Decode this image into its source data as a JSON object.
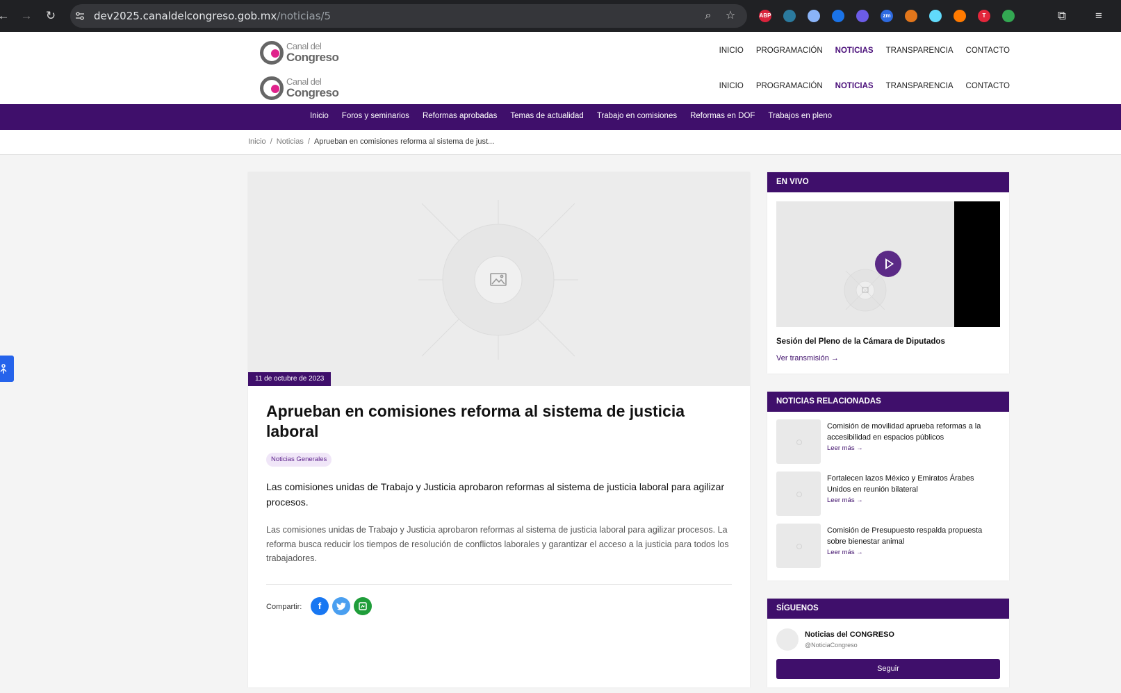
{
  "browser": {
    "url_host": "dev2025.canaldelcongreso.gob.mx",
    "url_path": "/noticias/5",
    "extensions": [
      {
        "name": "adblock-plus-icon",
        "label": "ABP",
        "color": "#d9233c"
      },
      {
        "name": "extension-icon-2",
        "label": "",
        "color": "#2b7a9e"
      },
      {
        "name": "extension-icon-3",
        "label": "",
        "color": "#8ab4f8"
      },
      {
        "name": "extension-icon-4",
        "label": "",
        "color": "#1a73e8"
      },
      {
        "name": "extension-icon-5",
        "label": "",
        "color": "#6c5ce7"
      },
      {
        "name": "zoom-extension-icon",
        "label": "zm",
        "color": "#2d6ae0"
      },
      {
        "name": "metamask-icon",
        "label": "",
        "color": "#e2761b"
      },
      {
        "name": "react-devtools-icon",
        "label": "",
        "color": "#61dafb"
      },
      {
        "name": "extension-icon-9",
        "label": "",
        "color": "#ff7a00"
      },
      {
        "name": "extension-icon-10",
        "label": "T",
        "color": "#e3263b"
      },
      {
        "name": "extension-icon-11",
        "label": "",
        "color": "#33a852"
      }
    ]
  },
  "site": {
    "logo_line1": "Canal del",
    "logo_line2": "Congreso",
    "nav": [
      "INICIO",
      "PROGRAMACIÓN",
      "NOTICIAS",
      "TRANSPARENCIA",
      "CONTACTO"
    ],
    "active_nav": "NOTICIAS",
    "subnav": [
      "Inicio",
      "Foros y seminarios",
      "Reformas aprobadas",
      "Temas de actualidad",
      "Trabajo en comisiones",
      "Reformas en DOF",
      "Trabajos en pleno"
    ],
    "breadcrumb": {
      "home": "Inicio",
      "section": "Noticias",
      "current": "Aprueban en comisiones reforma al sistema de just...",
      "separator": "/"
    }
  },
  "article": {
    "date": "11 de octubre de 2023",
    "title": "Aprueban en comisiones reforma al sistema de justicia laboral",
    "tag": "Noticias Generales",
    "lead": "Las comisiones unidas de Trabajo y Justicia aprobaron reformas al sistema de justicia laboral para agilizar procesos.",
    "body": "Las comisiones unidas de Trabajo y Justicia aprobaron reformas al sistema de justicia laboral para agilizar procesos. La reforma busca reducir los tiempos de resolución de conflictos laborales y garantizar el acceso a la justicia para todos los trabajadores.",
    "share_label": "Compartir:"
  },
  "sidebar": {
    "live": {
      "heading": "EN VIVO",
      "title": "Sesión del Pleno de la Cámara de Diputados",
      "link": "Ver transmisión →"
    },
    "related": {
      "heading": "NOTICIAS RELACIONADAS",
      "items": [
        {
          "title": "Comisión de movilidad aprueba reformas a la accesibilidad en espacios públicos",
          "link": "Leer más →"
        },
        {
          "title": "Fortalecen lazos México y Emiratos Árabes Unidos en reunión bilateral",
          "link": "Leer más →"
        },
        {
          "title": "Comisión de Presupuesto respalda propuesta sobre bienestar animal",
          "link": "Leer más →"
        }
      ]
    },
    "follow": {
      "heading": "SÍGUENOS",
      "name": "Noticias del CONGRESO",
      "handle": "@NoticiaCongreso",
      "button": "Seguir"
    }
  },
  "colors": {
    "brand_purple": "#3f0f6b",
    "facebook": "#1877f2",
    "twitter": "#4a9ff0",
    "whatsapp": "#1f9d3a"
  }
}
